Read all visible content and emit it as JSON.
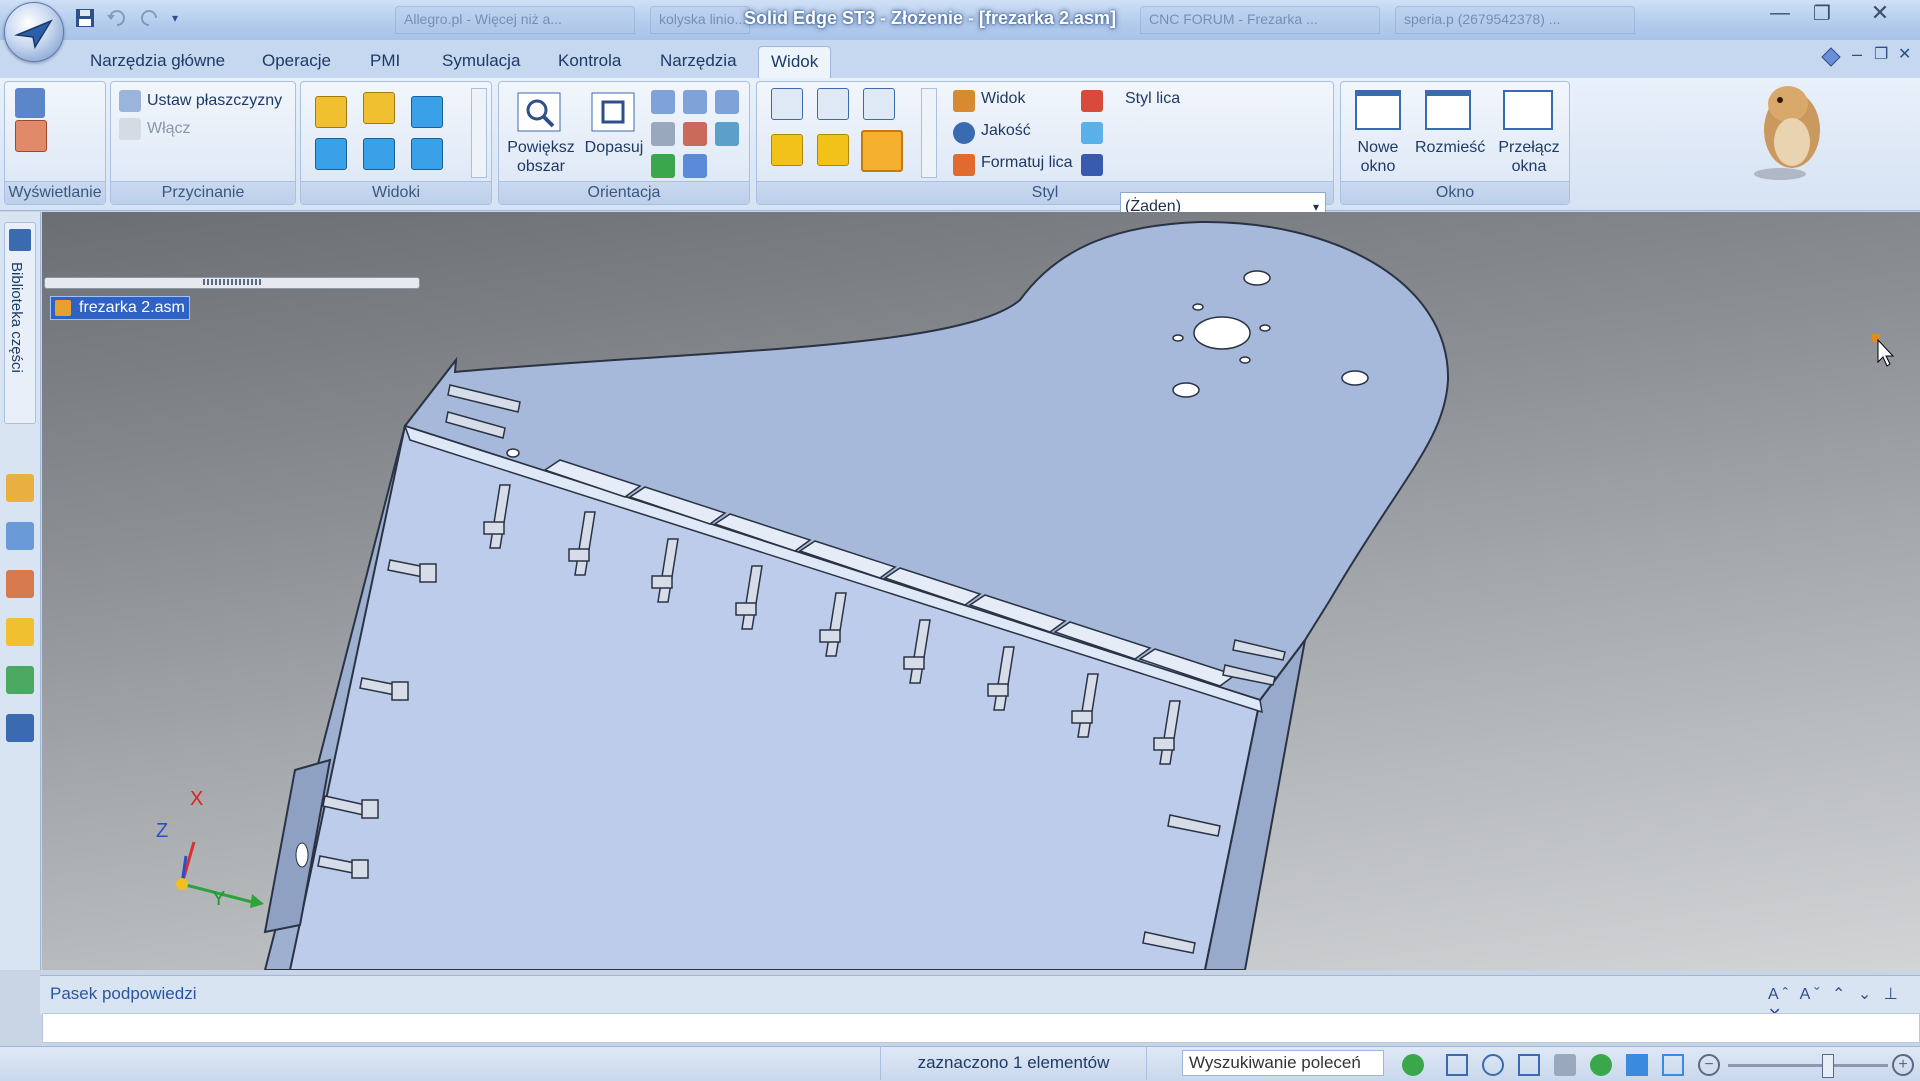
{
  "window": {
    "title": "Solid Edge ST3 - Złożenie - [frezarka 2.asm]",
    "browser_tabs": [
      "Allegro.pl - Więcej niż a...",
      "kolyska linio...",
      "CNC FORUM - Frezarka ...",
      "speria.p (2679542378) ..."
    ],
    "controls": {
      "minimize": "—",
      "restore": "❐",
      "close": "✕"
    }
  },
  "ribbon": {
    "tabs": [
      "Narzędzia główne",
      "Operacje",
      "PMI",
      "Symulacja",
      "Kontrola",
      "Narzędzia",
      "Widok"
    ],
    "active_tab": "Widok",
    "groups": {
      "display": {
        "label": "Wyświetlanie"
      },
      "clipping": {
        "label": "Przycinanie",
        "set_planes": "Ustaw płaszczyzny",
        "enable": "Włącz"
      },
      "views": {
        "label": "Widoki"
      },
      "orientation": {
        "label": "Orientacja",
        "zoom_area": "Powiększ obszar",
        "fit": "Dopasuj"
      },
      "style": {
        "label": "Styl",
        "view": "Widok",
        "quality": "Jakość",
        "format_faces": "Formatuj lica",
        "face_style_label": "Styl lica",
        "face_style_value": "(Żaden)"
      },
      "window": {
        "label": "Okno",
        "new_window": "Nowe okno",
        "arrange": "Rozmieść",
        "switch_windows": "Przełącz okna"
      }
    }
  },
  "sidebar": {
    "library_tab": "Biblioteka części"
  },
  "viewport": {
    "tree_node": "frezarka 2.asm",
    "axes": {
      "x": "X",
      "y": "Y",
      "z": "Z"
    }
  },
  "prompt_bar": {
    "title": "Pasek podpowiedzi",
    "controls": "Aˆ Aˇ ⌃ ⌄ ⊥ ✕"
  },
  "status_bar": {
    "selection": "zaznaczono 1 elementów",
    "command_search": "Wyszukiwanie poleceń"
  },
  "colors": {
    "accent": "#2f62c4",
    "ribbon_bg": "#dbe6f5",
    "model_face": "#bac9e6"
  }
}
